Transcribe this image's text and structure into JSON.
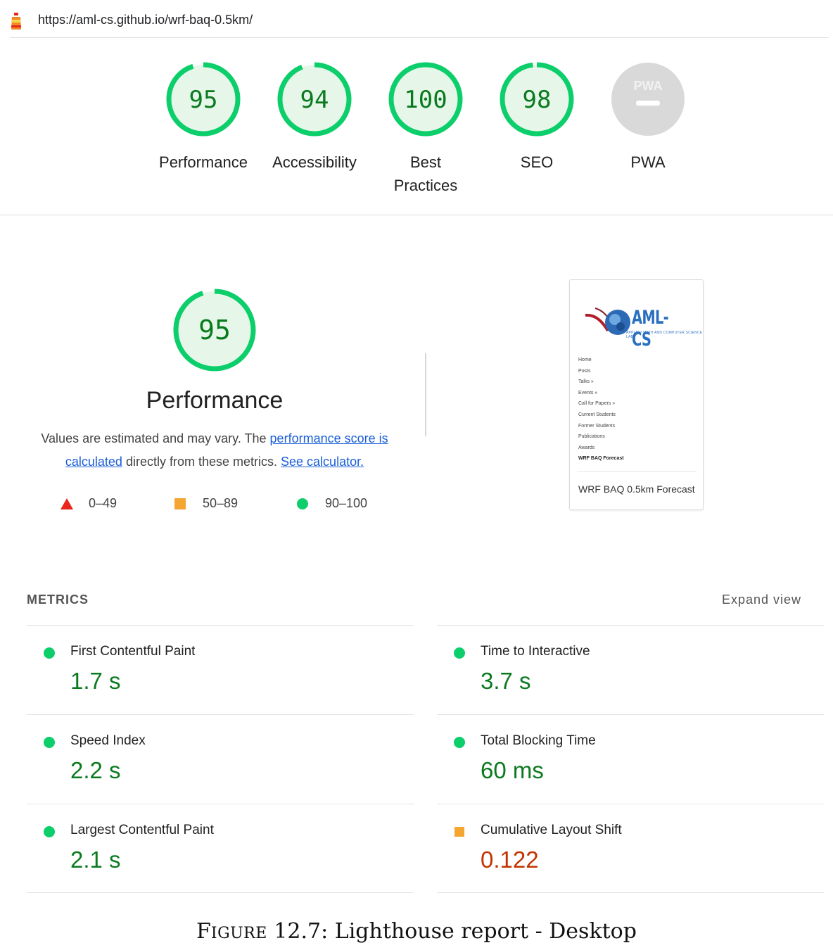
{
  "url_bar": {
    "url": "https://aml-cs.github.io/wrf-baq-0.5km/"
  },
  "colors": {
    "pass": "#0c9c2f",
    "pass_fill": "#e6f7ea",
    "pass_text": "#0a7a1f",
    "average": "#f4a532",
    "fail": "#e8261c",
    "average_text": "#c33300",
    "pwa_gray": "#d9d9d9"
  },
  "gauges": [
    {
      "label": "Performance",
      "score": "95"
    },
    {
      "label": "Accessibility",
      "score": "94"
    },
    {
      "label": "Best Practices",
      "score": "100"
    },
    {
      "label": "SEO",
      "score": "98"
    },
    {
      "label": "PWA",
      "badge": "PWA",
      "icon": "pwa-icon"
    }
  ],
  "performance": {
    "score": "95",
    "title": "Performance",
    "desc_prefix": "Values are estimated and may vary. The ",
    "score_link": "performance score is calculated",
    "desc_middle": " directly from these metrics. ",
    "calc_link": "See calculator.",
    "legend": [
      {
        "shape": "triangle",
        "range": "0–49"
      },
      {
        "shape": "square",
        "range": "50–89"
      },
      {
        "shape": "circle",
        "range": "90–100"
      }
    ]
  },
  "screenshot": {
    "brand": "AML-CS",
    "tagline": "APPLIED MATH AND COMPUTER SCIENCE LAB",
    "nav": [
      "Home",
      "Posts",
      "Talks »",
      "Events »",
      "Call for Papers »",
      "Current Students",
      "Former Students",
      "Publications",
      "Awards",
      "WRF BAQ Forecast"
    ],
    "heading": "WRF BAQ 0.5km Forecast"
  },
  "metrics": {
    "header": "METRICS",
    "expand_label": "Expand view",
    "items": [
      {
        "label": "First Contentful Paint",
        "value": "1.7 s",
        "rating": "pass"
      },
      {
        "label": "Time to Interactive",
        "value": "3.7 s",
        "rating": "pass"
      },
      {
        "label": "Speed Index",
        "value": "2.2 s",
        "rating": "pass"
      },
      {
        "label": "Total Blocking Time",
        "value": "60 ms",
        "rating": "pass"
      },
      {
        "label": "Largest Contentful Paint",
        "value": "2.1 s",
        "rating": "pass"
      },
      {
        "label": "Cumulative Layout Shift",
        "value": "0.122",
        "rating": "average"
      }
    ]
  },
  "caption": {
    "prefix": "F",
    "prefix_small": "IGURE",
    "text": " 12.7: Lighthouse report - Desktop"
  }
}
